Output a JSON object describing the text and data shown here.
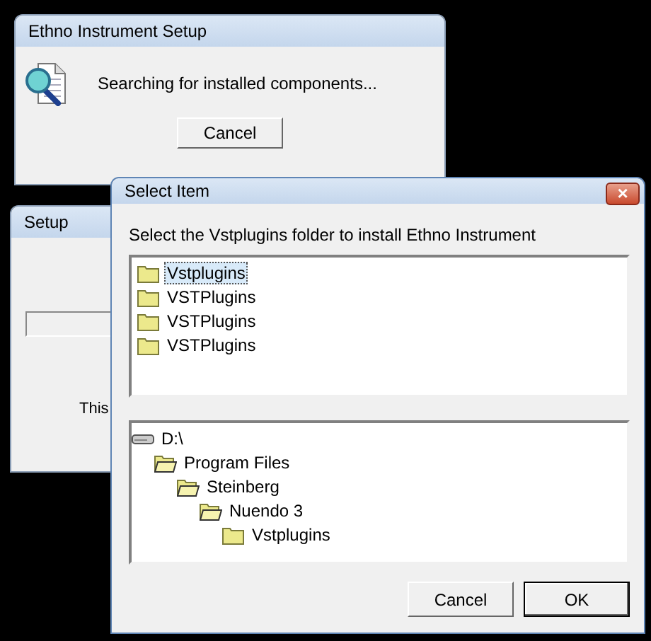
{
  "search_window": {
    "title": "Ethno Instrument Setup",
    "message": "Searching for installed components...",
    "cancel_button": "Cancel"
  },
  "setup_window": {
    "title": "Setup",
    "message": "This"
  },
  "select_dialog": {
    "title": "Select Item",
    "close_button": "×",
    "prompt": "Select the Vstplugins folder to install Ethno Instrument",
    "folder_list": [
      {
        "label": "Vstplugins",
        "selected": true
      },
      {
        "label": "VSTPlugins",
        "selected": false
      },
      {
        "label": "VSTPlugins",
        "selected": false
      },
      {
        "label": "VSTPlugins",
        "selected": false
      }
    ],
    "tree": [
      {
        "label": "D:\\",
        "kind": "drive",
        "children": [
          {
            "label": "Program Files",
            "kind": "folder",
            "expanded": true,
            "children": [
              {
                "label": "Steinberg",
                "kind": "folder",
                "expanded": true,
                "children": [
                  {
                    "label": "Nuendo 3",
                    "kind": "folder",
                    "expanded": true,
                    "children": [
                      {
                        "label": "Vstplugins",
                        "kind": "folder",
                        "expanded": false
                      }
                    ]
                  }
                ]
              }
            ]
          }
        ]
      }
    ],
    "buttons": [
      {
        "label": "Cancel",
        "default": false
      },
      {
        "label": "OK",
        "default": true
      }
    ]
  }
}
